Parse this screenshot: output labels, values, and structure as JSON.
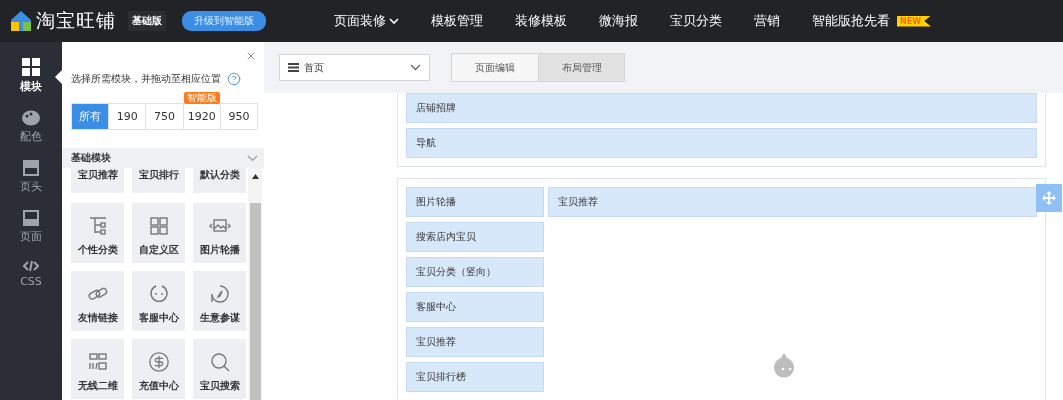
{
  "topbar": {
    "logo": "淘宝旺铺",
    "edition": "基础版",
    "upgrade": "升级到智能版",
    "nav": [
      {
        "label": "页面装修",
        "dropdown": true
      },
      {
        "label": "模板管理",
        "dropdown": false
      },
      {
        "label": "装修模板",
        "dropdown": false
      },
      {
        "label": "微海报",
        "dropdown": false
      },
      {
        "label": "宝贝分类",
        "dropdown": false
      },
      {
        "label": "营销",
        "dropdown": false
      },
      {
        "label": "智能版抢先看",
        "dropdown": false,
        "badge": "NEW"
      }
    ]
  },
  "rail": [
    {
      "label": "模块",
      "selected": true,
      "kind": "grid"
    },
    {
      "label": "配色",
      "selected": false,
      "kind": "palette"
    },
    {
      "label": "页头",
      "selected": false,
      "kind": "header"
    },
    {
      "label": "页面",
      "selected": false,
      "kind": "page"
    },
    {
      "label": "CSS",
      "selected": false,
      "kind": "code"
    }
  ],
  "panel": {
    "hint": "选择所需模块，并拖动至相应位置",
    "filters": [
      {
        "label": "所有",
        "selected": true
      },
      {
        "label": "190",
        "selected": false
      },
      {
        "label": "750",
        "selected": false
      },
      {
        "label": "1920",
        "selected": false,
        "badge": "智能版"
      },
      {
        "label": "950",
        "selected": false
      }
    ],
    "section": {
      "title": "基础模块",
      "expanded": true
    },
    "modules": [
      {
        "label": "宝贝推荐",
        "kind": "cut"
      },
      {
        "label": "宝贝排行",
        "kind": "cut"
      },
      {
        "label": "默认分类",
        "kind": "cut"
      },
      {
        "label": "个性分类",
        "kind": "tree"
      },
      {
        "label": "自定义区",
        "kind": "squares"
      },
      {
        "label": "图片轮播",
        "kind": "slides"
      },
      {
        "label": "友情链接",
        "kind": "link"
      },
      {
        "label": "客服中心",
        "kind": "face"
      },
      {
        "label": "生意参谋",
        "kind": "compass"
      },
      {
        "label": "无线二维",
        "kind": "qr"
      },
      {
        "label": "充值中心",
        "kind": "coin"
      },
      {
        "label": "宝贝搜索",
        "kind": "search"
      }
    ]
  },
  "main": {
    "page_select": "首页",
    "tabs": [
      {
        "label": "页面编辑",
        "selected": false
      },
      {
        "label": "布局管理",
        "selected": true
      }
    ],
    "header_rows": [
      "店铺招牌",
      "导航"
    ],
    "left_column": [
      "图片轮播",
      "搜索店内宝贝",
      "宝贝分类（竖向）",
      "客服中心",
      "宝贝推荐",
      "宝贝排行榜"
    ],
    "right_column": [
      "宝贝推荐"
    ]
  }
}
